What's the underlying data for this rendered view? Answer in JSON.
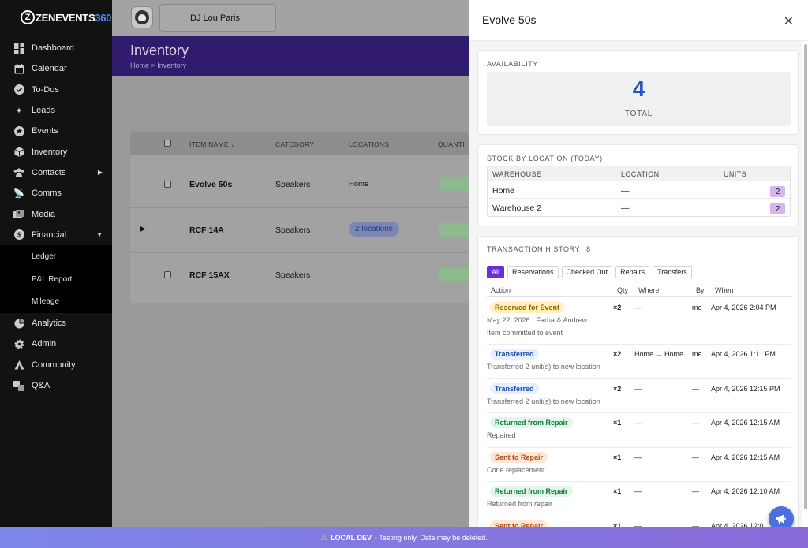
{
  "brand": {
    "z": "Z",
    "name_a": "ZENEVENTS",
    "name_b": "360"
  },
  "sidebar": {
    "items": [
      {
        "label": "Dashboard",
        "icon": "dashboard-icon"
      },
      {
        "label": "Calendar",
        "icon": "calendar-icon"
      },
      {
        "label": "To-Dos",
        "icon": "check-circle-icon"
      },
      {
        "label": "Leads",
        "icon": "sparkle-icon"
      },
      {
        "label": "Events",
        "icon": "star-icon"
      },
      {
        "label": "Inventory",
        "icon": "box-icon"
      },
      {
        "label": "Contacts",
        "icon": "users-icon"
      },
      {
        "label": "Comms",
        "icon": "satellite-icon"
      },
      {
        "label": "Media",
        "icon": "photos-icon"
      },
      {
        "label": "Financial",
        "icon": "dollar-icon"
      }
    ],
    "financial_sub": [
      "Ledger",
      "P&L Report",
      "Mileage"
    ],
    "items2": [
      {
        "label": "Analytics",
        "icon": "chart-icon"
      },
      {
        "label": "Admin",
        "icon": "gear-icon"
      },
      {
        "label": "Community",
        "icon": "tent-icon"
      },
      {
        "label": "Q&A",
        "icon": "translate-icon"
      }
    ],
    "contacts_arrow": "▶",
    "financial_arrow": "▼"
  },
  "topbar": {
    "profile": "DJ Lou Paris",
    "profile_dot": "·"
  },
  "hero": {
    "title": "Inventory",
    "breadcrumb": "Home > Inventory"
  },
  "table": {
    "headers": [
      "ITEM NAME ↓",
      "CATEGORY",
      "LOCATIONS",
      "QUANTI"
    ],
    "rows": [
      {
        "name": "Evolve 50s",
        "category": "Speakers",
        "location": "Home"
      },
      {
        "name": "RCF 14A",
        "category": "Speakers",
        "location": "2 locations",
        "expander": "▶"
      },
      {
        "name": "RCF 15AX",
        "category": "Speakers",
        "location": ""
      }
    ]
  },
  "drawer": {
    "title": "Evolve 50s",
    "close": "✕",
    "availability": {
      "title": "AVAILABILITY",
      "total": "4",
      "total_label": "TOTAL"
    },
    "stock": {
      "title": "STOCK BY LOCATION (TODAY)",
      "headers": [
        "WAREHOUSE",
        "LOCATION",
        "UNITS"
      ],
      "rows": [
        {
          "warehouse": "Home",
          "location": "—",
          "units": "2"
        },
        {
          "warehouse": "Warehouse 2",
          "location": "—",
          "units": "2"
        }
      ]
    },
    "history": {
      "title": "TRANSACTION HISTORY",
      "count": "8",
      "filters": [
        "All",
        "Reservations",
        "Checked Out",
        "Repairs",
        "Transfers"
      ],
      "headers": [
        "Action",
        "Qty",
        "Where",
        "By",
        "When"
      ],
      "rows": [
        {
          "action": "Reserved for Event",
          "kind": "res",
          "qty": "×2",
          "where": "—",
          "by": "me",
          "when": "Apr 4, 2026 2:04 PM",
          "d1": "May 22, 2026 · Farha & Andrew",
          "d2": "Item committed to event"
        },
        {
          "action": "Transferred",
          "kind": "trans",
          "qty": "×2",
          "where": "Home → Home",
          "by": "me",
          "when": "Apr 4, 2026 1:11 PM",
          "d1": "Transferred 2 unit(s) to new location",
          "d2": ""
        },
        {
          "action": "Transferred",
          "kind": "trans",
          "qty": "×2",
          "where": "—",
          "by": "—",
          "when": "Apr 4, 2026 12:15 PM",
          "d1": "Transferred 2 unit(s) to new location",
          "d2": ""
        },
        {
          "action": "Returned from Repair",
          "kind": "ret",
          "qty": "×1",
          "where": "—",
          "by": "—",
          "when": "Apr 4, 2026 12:15 AM",
          "d1": "Repaired",
          "d2": ""
        },
        {
          "action": "Sent to Repair",
          "kind": "sent",
          "qty": "×1",
          "where": "—",
          "by": "—",
          "when": "Apr 4, 2026 12:15 AM",
          "d1": "Cone replacement",
          "d2": ""
        },
        {
          "action": "Returned from Repair",
          "kind": "ret",
          "qty": "×1",
          "where": "—",
          "by": "—",
          "when": "Apr 4, 2026 12:10 AM",
          "d1": "Returned from repair",
          "d2": ""
        },
        {
          "action": "Sent to Repair",
          "kind": "sent",
          "qty": "×1",
          "where": "—",
          "by": "—",
          "when": "Apr 4, 2026 12:0",
          "d1": "",
          "d2": ""
        }
      ]
    }
  },
  "footer": {
    "icon": "⚠",
    "strong": "LOCAL DEV",
    "text": "- Testing only. Data may be deleted."
  },
  "fab": {
    "icon": "megaphone-icon"
  }
}
